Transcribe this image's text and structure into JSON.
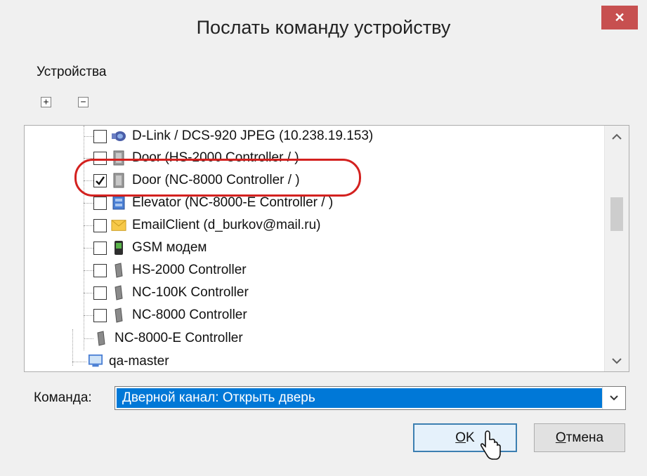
{
  "window": {
    "title": "Послать команду устройству",
    "close_icon": "close-icon",
    "accent_close": "#c75050"
  },
  "devices": {
    "label": "Устройства",
    "expand_all_glyph": "+",
    "collapse_all_glyph": "−"
  },
  "tree": {
    "items": [
      {
        "label": "D-Link / DCS-920 JPEG (10.238.19.153)",
        "icon": "camera-icon",
        "checked": false
      },
      {
        "label": "Door (HS-2000 Controller / )",
        "icon": "door-icon",
        "checked": false
      },
      {
        "label": "Door (NC-8000 Controller / )",
        "icon": "door-icon",
        "checked": true
      },
      {
        "label": "Elevator (NC-8000-E Controller / )",
        "icon": "elevator-icon",
        "checked": false
      },
      {
        "label": "EmailClient (d_burkov@mail.ru)",
        "icon": "email-icon",
        "checked": false
      },
      {
        "label": "GSM модем",
        "icon": "gsm-modem-icon",
        "checked": false
      },
      {
        "label": "HS-2000 Controller",
        "icon": "controller-icon",
        "checked": false
      },
      {
        "label": "NC-100K Controller",
        "icon": "controller-icon",
        "checked": false
      },
      {
        "label": "NC-8000 Controller",
        "icon": "controller-icon",
        "checked": false
      },
      {
        "label": "NC-8000-E Controller",
        "icon": "controller-icon",
        "checked": null
      },
      {
        "label": "qa-master",
        "icon": "computer-icon",
        "checked": null
      }
    ]
  },
  "command": {
    "label": "Команда:",
    "value": "Дверной канал: Открыть дверь",
    "selected_color": "#0078d7"
  },
  "buttons": {
    "ok_mnemonic": "О",
    "ok_rest": "K",
    "cancel_mnemonic": "О",
    "cancel_rest": "тмена"
  }
}
